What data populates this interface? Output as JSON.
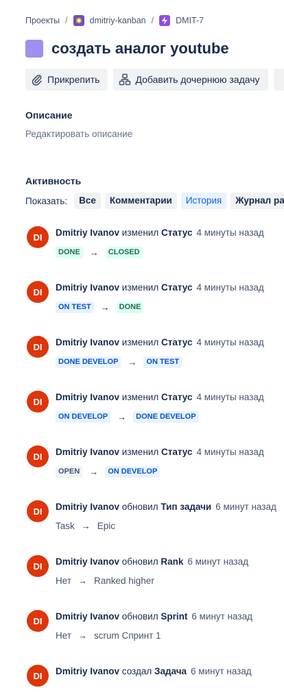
{
  "breadcrumb": {
    "projects": "Проекты",
    "separator": "/",
    "project": "dmitriy-kanban",
    "issue_key": "DMIT-7"
  },
  "issue": {
    "title": "создать аналог youtube",
    "type_color": "#9f8fef"
  },
  "toolbar": {
    "attach": "Прикрепить",
    "add_child": "Добавить дочернюю задачу"
  },
  "description": {
    "heading": "Описание",
    "placeholder": "Редактировать описание"
  },
  "activity": {
    "heading": "Активность",
    "show_label": "Показать:",
    "filters": [
      "Все",
      "Комментарии",
      "История",
      "Журнал ра"
    ],
    "active_filter": "История",
    "entries": [
      {
        "initials": "DI",
        "user": "Dmitriy Ivanov",
        "action": "изменил",
        "field": "Статус",
        "time": "4 минуты назад",
        "from": "DONE",
        "from_style": "green",
        "arrow": "→",
        "to": "CLOSED",
        "to_style": "green"
      },
      {
        "initials": "DI",
        "user": "Dmitriy Ivanov",
        "action": "изменил",
        "field": "Статус",
        "time": "4 минуты назад",
        "from": "ON TEST",
        "from_style": "blue",
        "arrow": "→",
        "to": "DONE",
        "to_style": "green"
      },
      {
        "initials": "DI",
        "user": "Dmitriy Ivanov",
        "action": "изменил",
        "field": "Статус",
        "time": "4 минуты назад",
        "from": "DONE DEVELOP",
        "from_style": "blue",
        "arrow": "→",
        "to": "ON TEST",
        "to_style": "blue"
      },
      {
        "initials": "DI",
        "user": "Dmitriy Ivanov",
        "action": "изменил",
        "field": "Статус",
        "time": "4 минуты назад",
        "from": "ON DEVELOP",
        "from_style": "blue",
        "arrow": "→",
        "to": "DONE DEVELOP",
        "to_style": "blue"
      },
      {
        "initials": "DI",
        "user": "Dmitriy Ivanov",
        "action": "изменил",
        "field": "Статус",
        "time": "4 минуты назад",
        "from": "OPEN",
        "from_style": "grey",
        "arrow": "→",
        "to": "ON DEVELOP",
        "to_style": "blue"
      },
      {
        "initials": "DI",
        "user": "Dmitriy Ivanov",
        "action": "обновил",
        "field": "Тип задачи",
        "time": "6 минут назад",
        "from": "Task",
        "from_style": "plain",
        "arrow": "→",
        "to": "Epic",
        "to_style": "plain"
      },
      {
        "initials": "DI",
        "user": "Dmitriy Ivanov",
        "action": "обновил",
        "field": "Rank",
        "time": "6 минут назад",
        "from": "Нет",
        "from_style": "plain",
        "arrow": "→",
        "to": "Ranked higher",
        "to_style": "plain"
      },
      {
        "initials": "DI",
        "user": "Dmitriy Ivanov",
        "action": "обновил",
        "field": "Sprint",
        "time": "6 минут назад",
        "from": "Нет",
        "from_style": "plain",
        "arrow": "→",
        "to": "scrum Спринт 1",
        "to_style": "plain"
      },
      {
        "initials": "DI",
        "user": "Dmitriy Ivanov",
        "action": "создал",
        "field": "Задача",
        "time": "6 минут назад"
      }
    ]
  },
  "colors": {
    "avatar": "#de350b",
    "green_bg": "#dcfff1",
    "green_text": "#216e4e",
    "blue_bg": "#e9f2ff",
    "blue_text": "#0055cc",
    "grey_bg": "#f1f2f4",
    "grey_text": "#44546f"
  }
}
